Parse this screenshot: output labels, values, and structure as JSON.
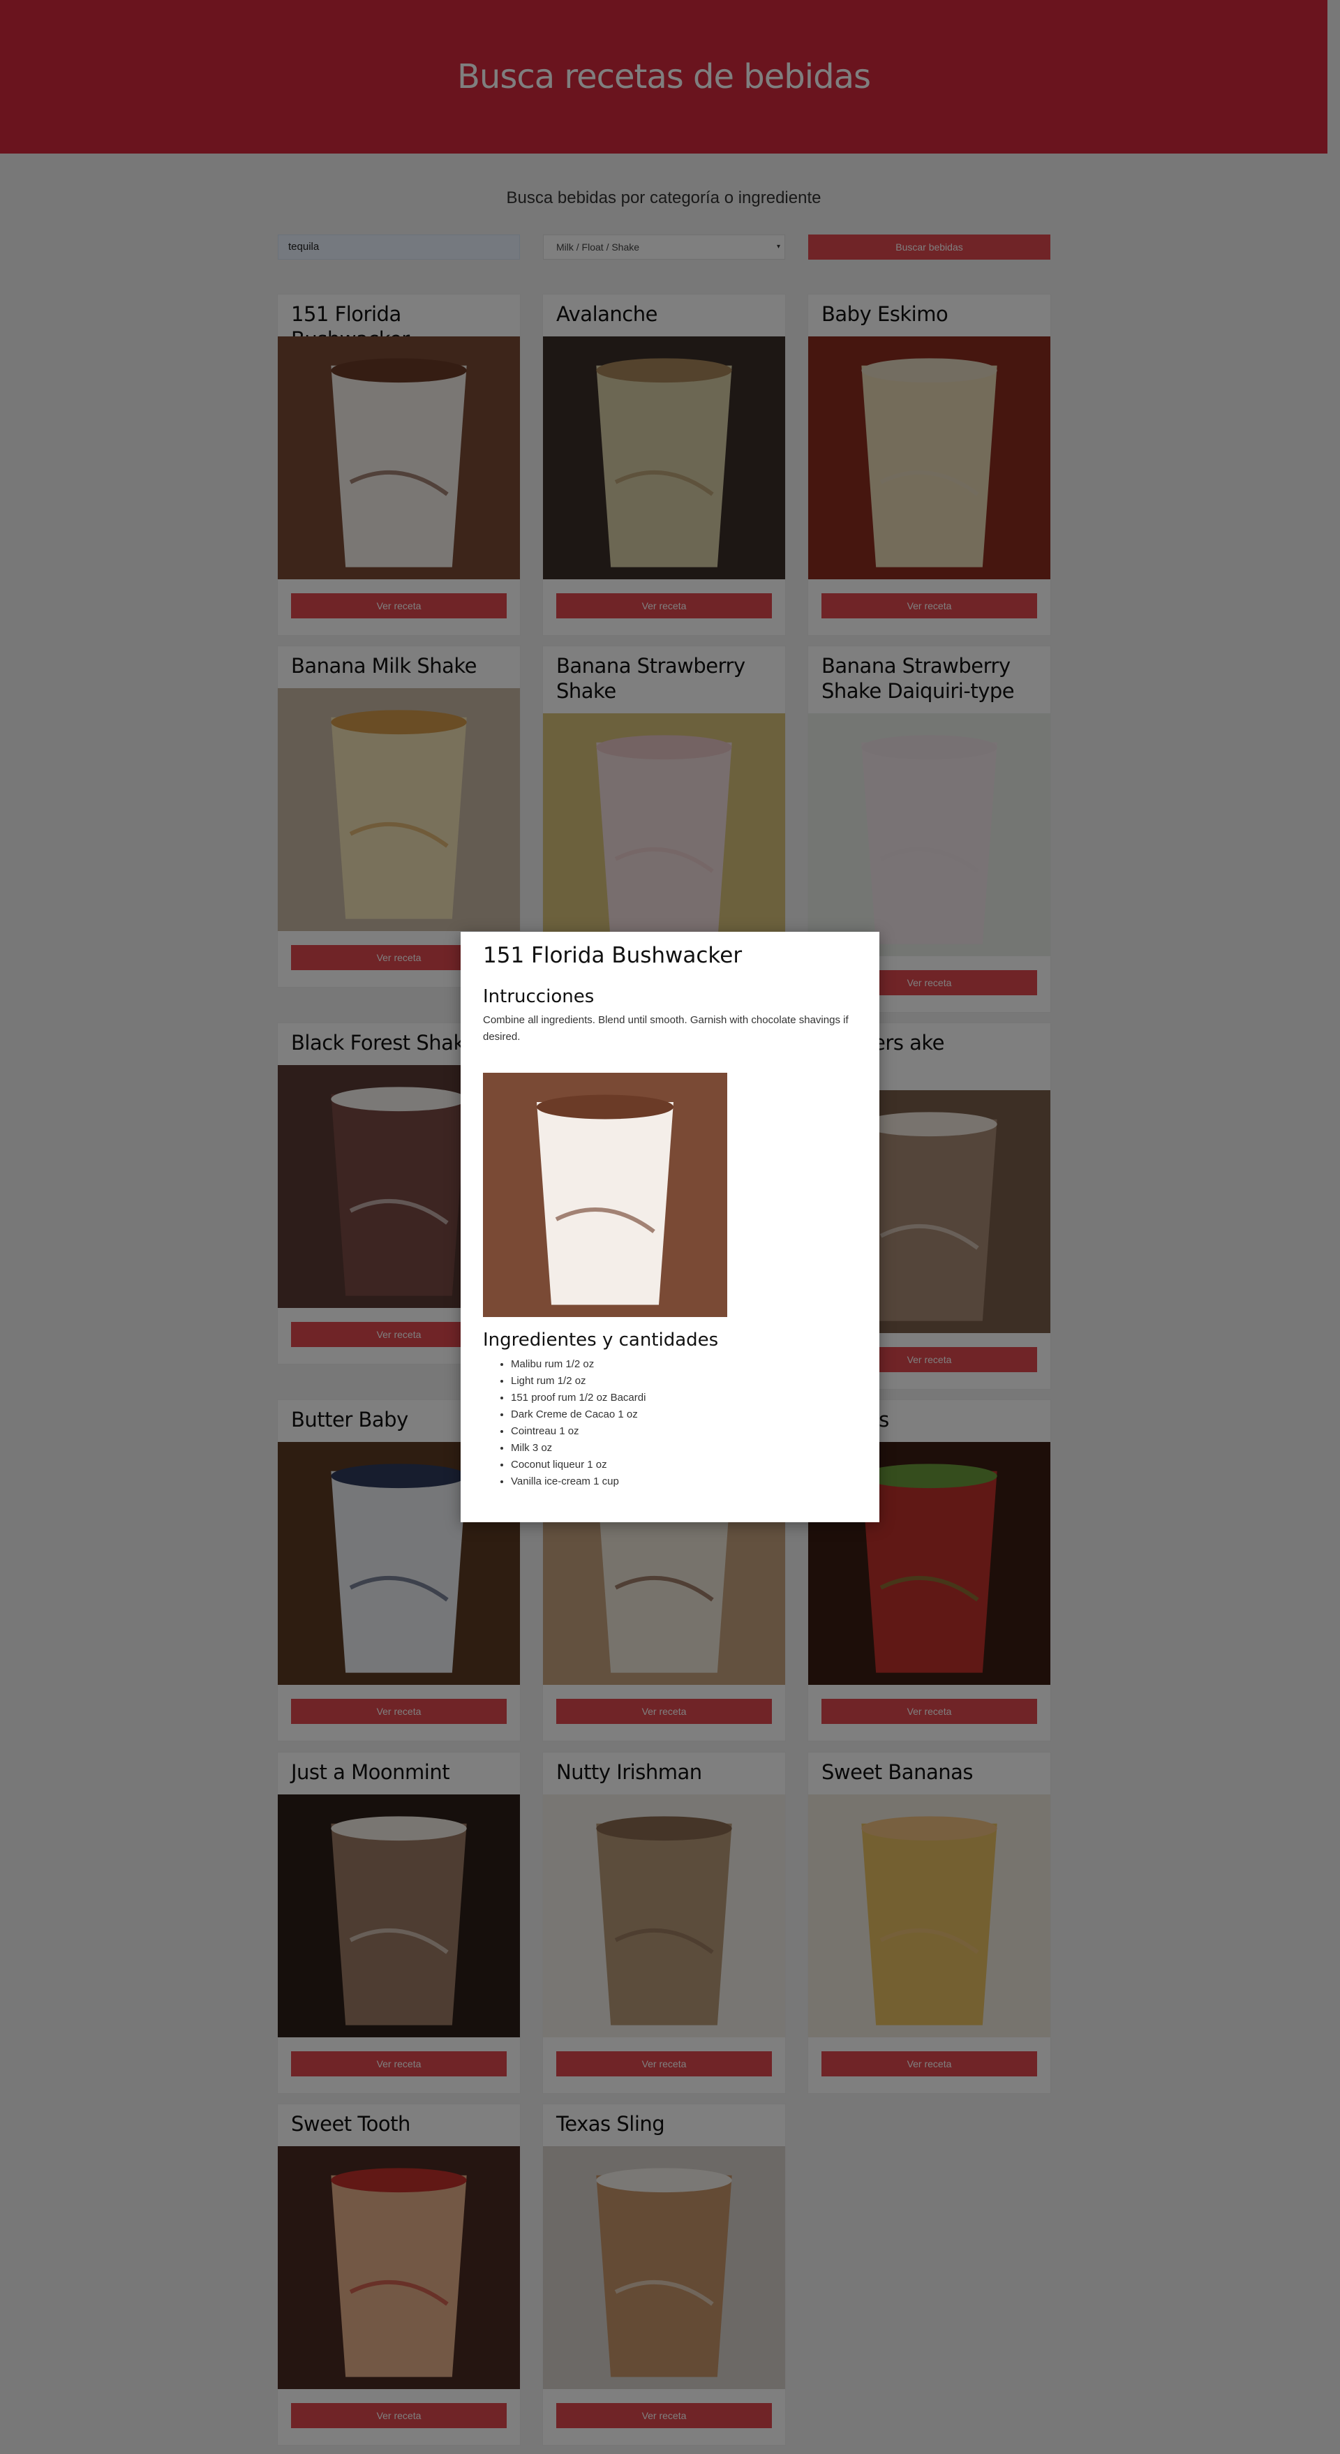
{
  "header": {
    "title": "Busca recetas de bebidas"
  },
  "search": {
    "subtitle": "Busca bebidas por categoría o ingrediente",
    "ingredient_value": "tequila",
    "category_selected": "Milk / Float / Shake",
    "button_label": "Buscar bebidas"
  },
  "colors": {
    "accent": "#d5283c",
    "button": "#e0484e"
  },
  "cards": [
    {
      "title": "151 Florida Bushwacker",
      "button": "Ver receta",
      "icon": "drink-photo"
    },
    {
      "title": "Avalanche",
      "button": "Ver receta",
      "icon": "drink-photo"
    },
    {
      "title": "Baby Eskimo",
      "button": "Ver receta",
      "icon": "drink-photo"
    },
    {
      "title": "Banana Milk Shake",
      "button": "Ver receta",
      "icon": "drink-photo"
    },
    {
      "title": "Banana Strawberry Shake",
      "button": "Ver receta",
      "icon": "drink-photo"
    },
    {
      "title": "Banana Strawberry Shake Daiquiri-type",
      "button": "Ver receta",
      "icon": "drink-photo"
    },
    {
      "title": "Black Forest Shake",
      "button": "Ver receta",
      "icon": "drink-photo"
    },
    {
      "title": "",
      "button": "Ver receta",
      "icon": "drink-photo"
    },
    {
      "title": "Snickers ake",
      "button": "Ver receta",
      "icon": "drink-photo"
    },
    {
      "title": "Butter Baby",
      "button": "Ver receta",
      "icon": "drink-photo"
    },
    {
      "title": "",
      "button": "Ver receta",
      "icon": "drink-photo"
    },
    {
      "title": "ca Kiss",
      "button": "Ver receta",
      "icon": "drink-photo"
    },
    {
      "title": "Just a Moonmint",
      "button": "Ver receta",
      "icon": "drink-photo"
    },
    {
      "title": "Nutty Irishman",
      "button": "Ver receta",
      "icon": "drink-photo"
    },
    {
      "title": "Sweet Bananas",
      "button": "Ver receta",
      "icon": "drink-photo"
    },
    {
      "title": "Sweet Tooth",
      "button": "Ver receta",
      "icon": "drink-photo"
    },
    {
      "title": "Texas Sling",
      "button": "Ver receta",
      "icon": "drink-photo"
    }
  ],
  "modal": {
    "title": "151 Florida Bushwacker",
    "instructions_heading": "Intrucciones",
    "instructions": "Combine all ingredients. Blend until smooth. Garnish with chocolate shavings if desired.",
    "ingredients_heading": "Ingredientes y cantidades",
    "ingredients": [
      "Malibu rum 1/2 oz",
      "Light rum 1/2 oz",
      "151 proof rum 1/2 oz Bacardi",
      "Dark Creme de Cacao 1 oz",
      "Cointreau 1 oz",
      "Milk 3 oz",
      "Coconut liqueur 1 oz",
      "Vanilla ice-cream 1 cup"
    ]
  }
}
